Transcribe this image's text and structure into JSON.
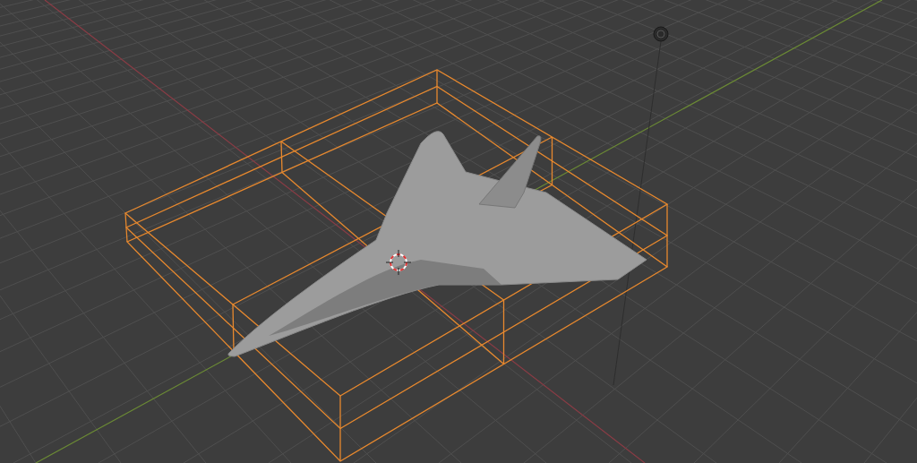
{
  "lattice": {
    "selected": true
  }
}
